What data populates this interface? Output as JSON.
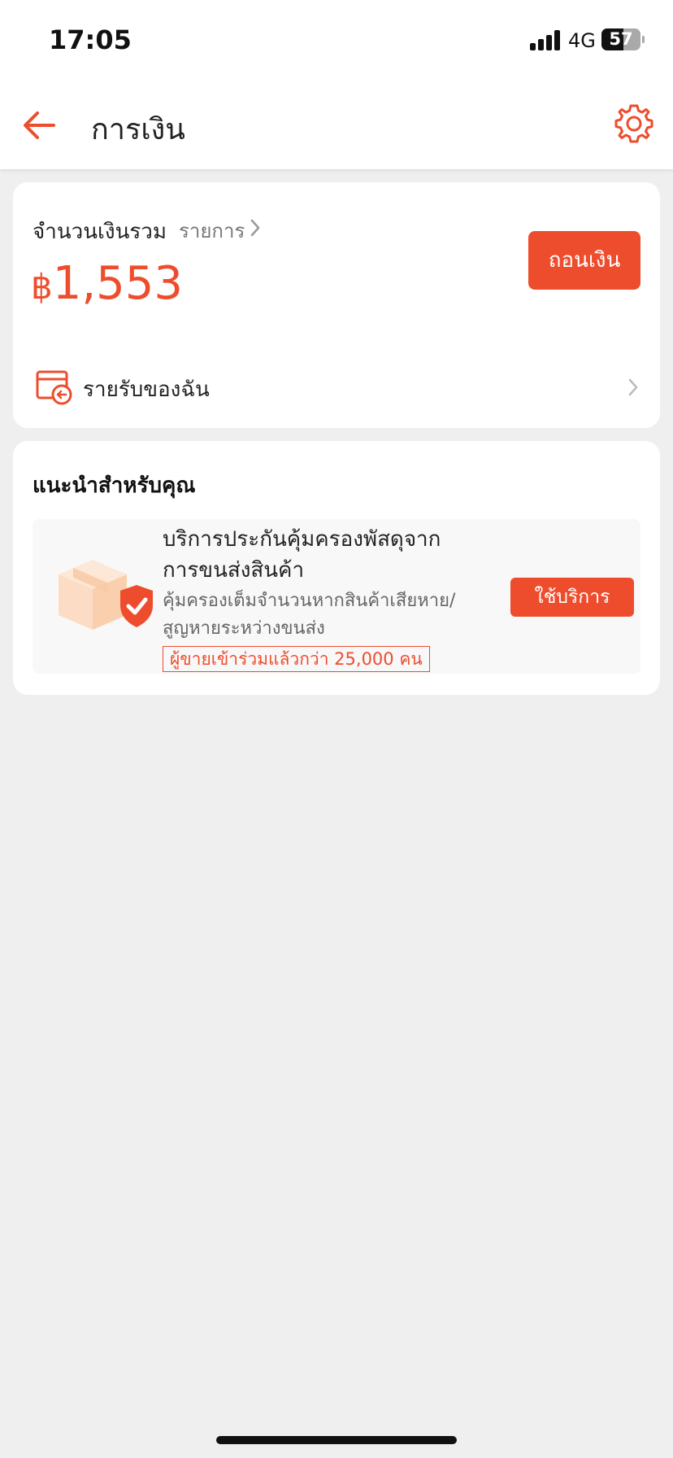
{
  "status_bar": {
    "time": "17:05",
    "network": "4G",
    "battery": "57",
    "battery_level_percent": 57
  },
  "header": {
    "title": "การเงิน",
    "back_icon": "arrow-left-icon",
    "settings_icon": "gear-icon"
  },
  "balance": {
    "label": "จำนวนเงินรวม",
    "transactions_link": "รายการ",
    "currency_symbol": "฿",
    "amount": "1,553",
    "withdraw_label": "ถอนเงิน",
    "income_label": "รายรับของฉัน"
  },
  "recommend": {
    "title": "แนะนำสำหรับคุณ",
    "promo": {
      "title": "บริการประกันคุ้มครองพัสดุจากการขนส่งสินค้า",
      "description": "คุ้มครองเต็มจำนวนหากสินค้าเสียหาย/สูญหายระหว่างขนส่ง",
      "badge": "ผู้ขายเข้าร่วมแล้วกว่า 25,000 คน",
      "button_label": "ใช้บริการ"
    }
  },
  "colors": {
    "accent": "#ee4d2d",
    "background": "#efefef"
  }
}
